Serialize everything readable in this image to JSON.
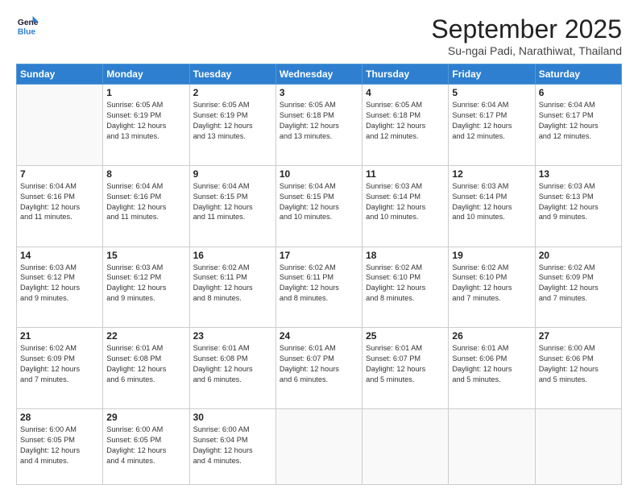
{
  "logo": {
    "line1": "General",
    "line2": "Blue"
  },
  "header": {
    "title": "September 2025",
    "subtitle": "Su-ngai Padi, Narathiwat, Thailand"
  },
  "weekdays": [
    "Sunday",
    "Monday",
    "Tuesday",
    "Wednesday",
    "Thursday",
    "Friday",
    "Saturday"
  ],
  "weeks": [
    [
      {
        "day": "",
        "info": ""
      },
      {
        "day": "1",
        "info": "Sunrise: 6:05 AM\nSunset: 6:19 PM\nDaylight: 12 hours\nand 13 minutes."
      },
      {
        "day": "2",
        "info": "Sunrise: 6:05 AM\nSunset: 6:19 PM\nDaylight: 12 hours\nand 13 minutes."
      },
      {
        "day": "3",
        "info": "Sunrise: 6:05 AM\nSunset: 6:18 PM\nDaylight: 12 hours\nand 13 minutes."
      },
      {
        "day": "4",
        "info": "Sunrise: 6:05 AM\nSunset: 6:18 PM\nDaylight: 12 hours\nand 12 minutes."
      },
      {
        "day": "5",
        "info": "Sunrise: 6:04 AM\nSunset: 6:17 PM\nDaylight: 12 hours\nand 12 minutes."
      },
      {
        "day": "6",
        "info": "Sunrise: 6:04 AM\nSunset: 6:17 PM\nDaylight: 12 hours\nand 12 minutes."
      }
    ],
    [
      {
        "day": "7",
        "info": "Sunrise: 6:04 AM\nSunset: 6:16 PM\nDaylight: 12 hours\nand 11 minutes."
      },
      {
        "day": "8",
        "info": "Sunrise: 6:04 AM\nSunset: 6:16 PM\nDaylight: 12 hours\nand 11 minutes."
      },
      {
        "day": "9",
        "info": "Sunrise: 6:04 AM\nSunset: 6:15 PM\nDaylight: 12 hours\nand 11 minutes."
      },
      {
        "day": "10",
        "info": "Sunrise: 6:04 AM\nSunset: 6:15 PM\nDaylight: 12 hours\nand 10 minutes."
      },
      {
        "day": "11",
        "info": "Sunrise: 6:03 AM\nSunset: 6:14 PM\nDaylight: 12 hours\nand 10 minutes."
      },
      {
        "day": "12",
        "info": "Sunrise: 6:03 AM\nSunset: 6:14 PM\nDaylight: 12 hours\nand 10 minutes."
      },
      {
        "day": "13",
        "info": "Sunrise: 6:03 AM\nSunset: 6:13 PM\nDaylight: 12 hours\nand 9 minutes."
      }
    ],
    [
      {
        "day": "14",
        "info": "Sunrise: 6:03 AM\nSunset: 6:12 PM\nDaylight: 12 hours\nand 9 minutes."
      },
      {
        "day": "15",
        "info": "Sunrise: 6:03 AM\nSunset: 6:12 PM\nDaylight: 12 hours\nand 9 minutes."
      },
      {
        "day": "16",
        "info": "Sunrise: 6:02 AM\nSunset: 6:11 PM\nDaylight: 12 hours\nand 8 minutes."
      },
      {
        "day": "17",
        "info": "Sunrise: 6:02 AM\nSunset: 6:11 PM\nDaylight: 12 hours\nand 8 minutes."
      },
      {
        "day": "18",
        "info": "Sunrise: 6:02 AM\nSunset: 6:10 PM\nDaylight: 12 hours\nand 8 minutes."
      },
      {
        "day": "19",
        "info": "Sunrise: 6:02 AM\nSunset: 6:10 PM\nDaylight: 12 hours\nand 7 minutes."
      },
      {
        "day": "20",
        "info": "Sunrise: 6:02 AM\nSunset: 6:09 PM\nDaylight: 12 hours\nand 7 minutes."
      }
    ],
    [
      {
        "day": "21",
        "info": "Sunrise: 6:02 AM\nSunset: 6:09 PM\nDaylight: 12 hours\nand 7 minutes."
      },
      {
        "day": "22",
        "info": "Sunrise: 6:01 AM\nSunset: 6:08 PM\nDaylight: 12 hours\nand 6 minutes."
      },
      {
        "day": "23",
        "info": "Sunrise: 6:01 AM\nSunset: 6:08 PM\nDaylight: 12 hours\nand 6 minutes."
      },
      {
        "day": "24",
        "info": "Sunrise: 6:01 AM\nSunset: 6:07 PM\nDaylight: 12 hours\nand 6 minutes."
      },
      {
        "day": "25",
        "info": "Sunrise: 6:01 AM\nSunset: 6:07 PM\nDaylight: 12 hours\nand 5 minutes."
      },
      {
        "day": "26",
        "info": "Sunrise: 6:01 AM\nSunset: 6:06 PM\nDaylight: 12 hours\nand 5 minutes."
      },
      {
        "day": "27",
        "info": "Sunrise: 6:00 AM\nSunset: 6:06 PM\nDaylight: 12 hours\nand 5 minutes."
      }
    ],
    [
      {
        "day": "28",
        "info": "Sunrise: 6:00 AM\nSunset: 6:05 PM\nDaylight: 12 hours\nand 4 minutes."
      },
      {
        "day": "29",
        "info": "Sunrise: 6:00 AM\nSunset: 6:05 PM\nDaylight: 12 hours\nand 4 minutes."
      },
      {
        "day": "30",
        "info": "Sunrise: 6:00 AM\nSunset: 6:04 PM\nDaylight: 12 hours\nand 4 minutes."
      },
      {
        "day": "",
        "info": ""
      },
      {
        "day": "",
        "info": ""
      },
      {
        "day": "",
        "info": ""
      },
      {
        "day": "",
        "info": ""
      }
    ]
  ]
}
